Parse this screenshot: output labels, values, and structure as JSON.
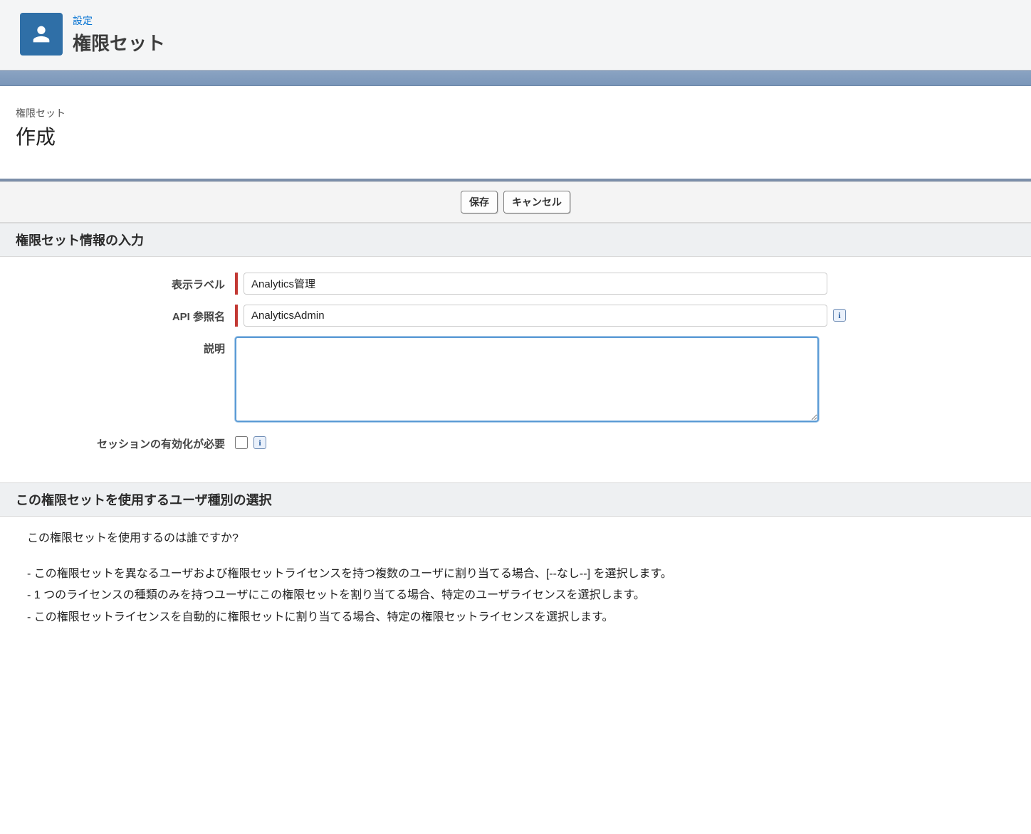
{
  "header": {
    "breadcrumb": "設定",
    "title": "権限セット"
  },
  "subheader": {
    "label": "権限セット",
    "title": "作成"
  },
  "buttons": {
    "save": "保存",
    "cancel": "キャンセル"
  },
  "sections": {
    "info_title": "権限セット情報の入力",
    "user_type_title": "この権限セットを使用するユーザ種別の選択"
  },
  "form": {
    "display_label": {
      "label": "表示ラベル",
      "value": "Analytics管理"
    },
    "api_name": {
      "label": "API 参照名",
      "value": "AnalyticsAdmin"
    },
    "description": {
      "label": "説明",
      "value": ""
    },
    "session_activation": {
      "label": "セッションの有効化が必要"
    }
  },
  "help": {
    "question": "この権限セットを使用するのは誰ですか?",
    "items": [
      "- この権限セットを異なるユーザおよび権限セットライセンスを持つ複数のユーザに割り当てる場合、[--なし--] を選択します。",
      "- 1 つのライセンスの種類のみを持つユーザにこの権限セットを割り当てる場合、特定のユーザライセンスを選択します。",
      "- この権限セットライセンスを自動的に権限セットに割り当てる場合、特定の権限セットライセンスを選択します。"
    ]
  },
  "info_glyph": "i"
}
